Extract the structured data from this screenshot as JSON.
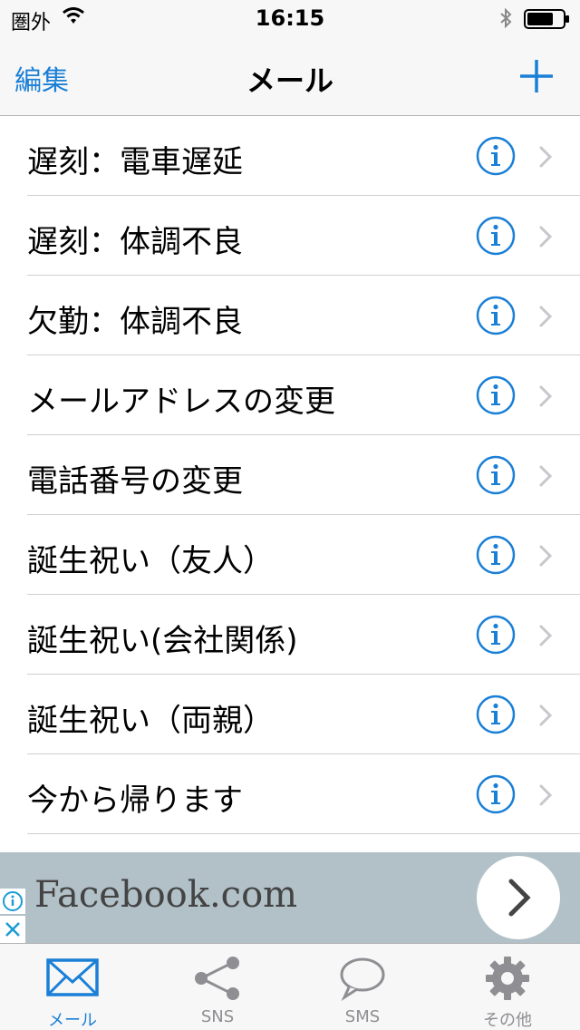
{
  "status": {
    "carrier": "圏外",
    "time": "16:15"
  },
  "nav": {
    "edit_label": "編集",
    "title": "メール"
  },
  "rows": [
    {
      "label": "遅刻：電車遅延"
    },
    {
      "label": "遅刻：体調不良"
    },
    {
      "label": "欠勤：体調不良"
    },
    {
      "label": "メールアドレスの変更"
    },
    {
      "label": "電話番号の変更"
    },
    {
      "label": "誕生祝い（友人）"
    },
    {
      "label": "誕生祝い(会社関係)"
    },
    {
      "label": "誕生祝い（両親）"
    },
    {
      "label": "今から帰ります"
    }
  ],
  "ad": {
    "text": "Facebook.com"
  },
  "tabs": [
    {
      "label": "メール",
      "icon": "envelope-icon"
    },
    {
      "label": "SNS",
      "icon": "share-icon"
    },
    {
      "label": "SMS",
      "icon": "speech-bubble-icon"
    },
    {
      "label": "その他",
      "icon": "gear-icon"
    }
  ],
  "colors": {
    "accent": "#1a7fd6",
    "inactive": "#8e8e93",
    "ad_background": "#b2c1c8"
  }
}
